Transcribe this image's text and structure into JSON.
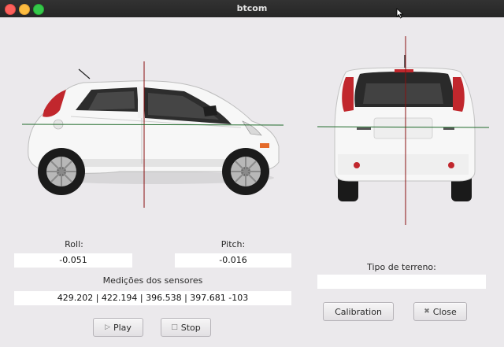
{
  "window": {
    "title": "btcom"
  },
  "roll": {
    "label": "Roll:",
    "value": "-0.051"
  },
  "pitch": {
    "label": "Pitch:",
    "value": "-0.016"
  },
  "sensors": {
    "label": "Medições dos sensores",
    "value": "429.202 | 422.194 | 396.538 | 397.681 -103"
  },
  "terrain": {
    "label": "Tipo de terreno:",
    "value": ""
  },
  "buttons": {
    "play": {
      "label": "Play",
      "icon": "play-icon"
    },
    "stop": {
      "label": "Stop",
      "icon": "stop-icon"
    },
    "calibration": {
      "label": "Calibration"
    },
    "close": {
      "label": "Close",
      "icon": "close-icon"
    }
  },
  "colors": {
    "crosshair_vertical": "#8a1010",
    "crosshair_horizontal": "#1f6a2a",
    "window_bg": "#ebe9ec",
    "titlebar_bg": "#2b2b2b"
  }
}
